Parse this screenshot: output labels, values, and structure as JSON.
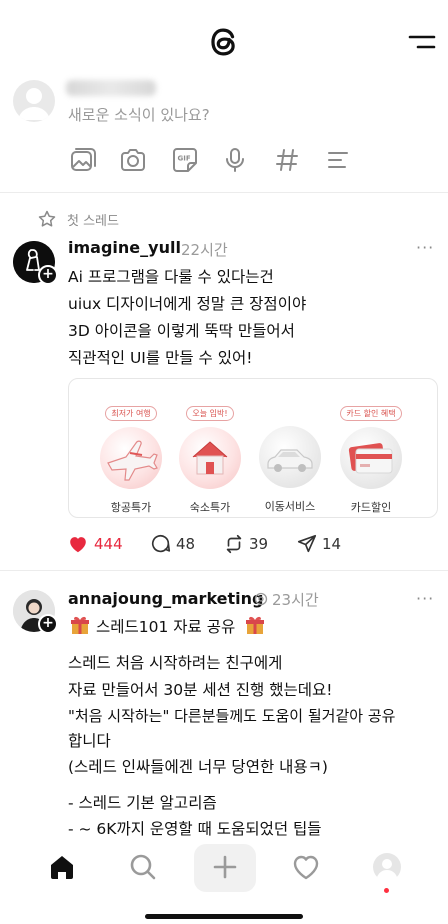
{
  "composer": {
    "placeholder": "새로운 소식이 있나요?",
    "tools": [
      "image-icon",
      "camera-icon",
      "gif-icon",
      "mic-icon",
      "hashtag-icon",
      "poll-icon"
    ]
  },
  "section": {
    "label": "첫 스레드"
  },
  "post1": {
    "username": "imagine_yull",
    "time": "22시간",
    "more": "···",
    "lines": [
      "Ai 프로그램을 다룰 수 있다는건",
      "uiux 디자이너에게 정말 큰 장점이야",
      "3D 아이콘을 이렇게 뚝딱 만들어서",
      "직관적인 UI를 만들 수 있어!"
    ],
    "tiles": [
      {
        "tag": "최저가 여행",
        "label": "항공특가",
        "icon": "airplane-icon"
      },
      {
        "tag": "오늘 입박!",
        "label": "숙소특가",
        "icon": "house-icon"
      },
      {
        "tag": "",
        "label": "이동서비스",
        "icon": "car-icon"
      },
      {
        "tag": "카드 할인 혜택",
        "label": "카드할인",
        "icon": "card-icon"
      }
    ],
    "likes": "444",
    "comments": "48",
    "reposts": "39",
    "shares": "14",
    "accent": "#e8293f"
  },
  "post2": {
    "username": "annajoung_marketing",
    "time": "23시간",
    "more": "···",
    "title": "스레드101 자료 공유",
    "lines": [
      "스레드 처음 시작하려는 친구에게",
      "자료 만들어서 30분 세션 진행 했는데요!",
      "\"처음 시작하는\" 다른분들께도 도움이 될거같아 공유",
      "합니다",
      "(스레드 인싸들에겐 너무 당연한 내용ㅋ)",
      "",
      "- 스레드 기본 알고리즘",
      "- ~ 6K까지 운영할 때 도움되었던 팁들"
    ]
  },
  "nav": {
    "items": [
      "home-icon",
      "search-icon",
      "plus-icon",
      "heart-icon",
      "profile-icon"
    ]
  }
}
